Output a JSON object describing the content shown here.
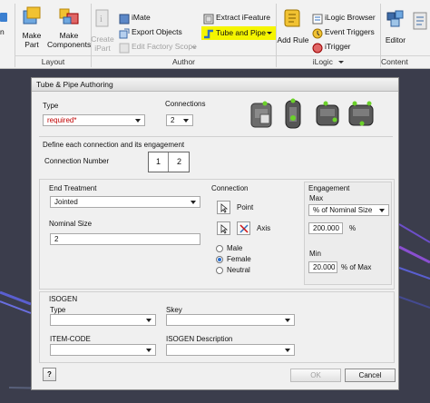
{
  "ribbon": {
    "buttons": {
      "make_part": "Make\nPart",
      "make_components": "Make\nComponents",
      "create_ipart": "Create\niPart",
      "imate": "iMate",
      "export_objects": "Export Objects",
      "edit_factory_scope": "Edit Factory Scope",
      "extract_ifeature": "Extract iFeature",
      "tube_and_pipe": "Tube and Pipe",
      "add_rule": "Add Rule",
      "ilogic_browser": "iLogic Browser",
      "event_triggers": "Event Triggers",
      "itrigger": "iTrigger",
      "editor": "Editor"
    },
    "groups": {
      "layout": "Layout",
      "author": "Author",
      "ilogic": "iLogic",
      "content_center": "Content Center"
    },
    "highlight_color": "#f5f500"
  },
  "dialog": {
    "title": "Tube & Pipe Authoring",
    "type_label": "Type",
    "type_value": "required*",
    "type_value_color": "#c00000",
    "connections_label": "Connections",
    "connections_value": "2",
    "define_text": "Define each connection and its engagement",
    "connection_number_label": "Connection Number",
    "connection_tabs": [
      "1",
      "2"
    ],
    "end_treatment_label": "End Treatment",
    "end_treatment_value": "Jointed",
    "nominal_size_label": "Nominal Size",
    "nominal_size_value": "2",
    "connection_group_label": "Connection",
    "point_label": "Point",
    "axis_label": "Axis",
    "gender_options": [
      "Male",
      "Female",
      "Neutral"
    ],
    "gender_selected": "Female",
    "engagement_label": "Engagement",
    "max_label": "Max",
    "max_mode_value": "% of Nominal Size",
    "max_value": "200.000",
    "max_unit": "%",
    "min_label": "Min",
    "min_value": "20.000",
    "min_unit": "% of Max",
    "isogen_label": "ISOGEN",
    "isogen_type_label": "Type",
    "skey_label": "Skey",
    "item_code_label": "ITEM-CODE",
    "isogen_desc_label": "ISOGEN Description",
    "help_label": "?",
    "ok_label": "OK",
    "cancel_label": "Cancel"
  }
}
